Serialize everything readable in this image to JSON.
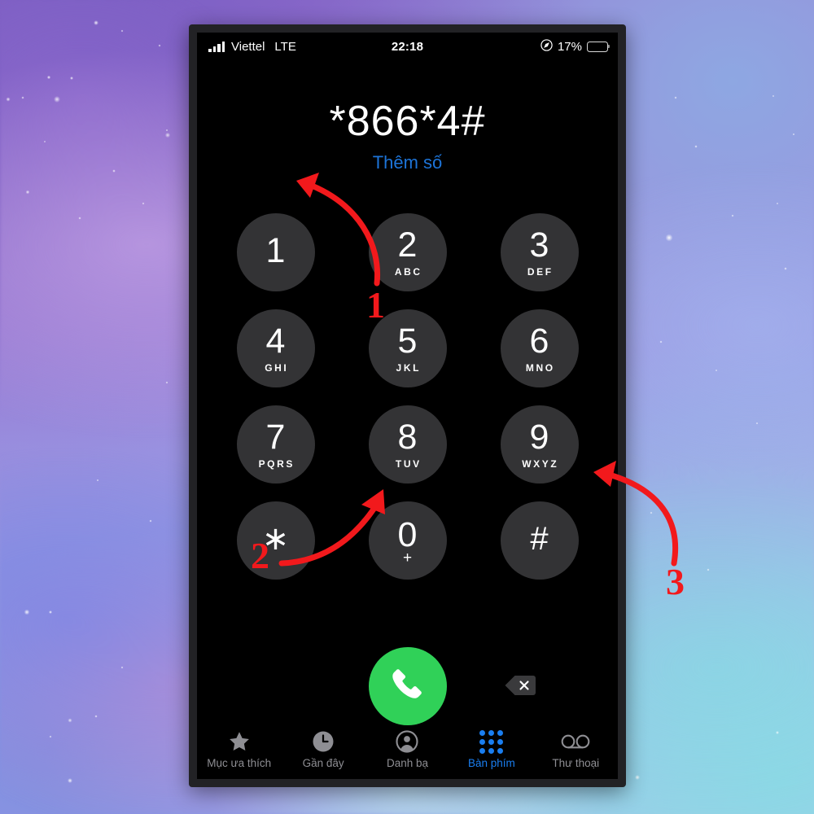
{
  "status_bar": {
    "signal_icon": "signal-bars-icon",
    "carrier": "Viettel",
    "network": "LTE",
    "time": "22:18",
    "location_icon": "location-arrow-icon",
    "battery_percent": "17%",
    "battery_level": 17,
    "battery_color": "#e53027"
  },
  "dialer": {
    "number": "*866*4#",
    "add_number_label": "Thêm số",
    "add_number_color": "#1d74d8",
    "keys": [
      {
        "digit": "1",
        "letters": ""
      },
      {
        "digit": "2",
        "letters": "ABC"
      },
      {
        "digit": "3",
        "letters": "DEF"
      },
      {
        "digit": "4",
        "letters": "GHI"
      },
      {
        "digit": "5",
        "letters": "JKL"
      },
      {
        "digit": "6",
        "letters": "MNO"
      },
      {
        "digit": "7",
        "letters": "PQRS"
      },
      {
        "digit": "8",
        "letters": "TUV"
      },
      {
        "digit": "9",
        "letters": "WXYZ"
      },
      {
        "digit": "∗",
        "letters": ""
      },
      {
        "digit": "0",
        "letters": "+"
      },
      {
        "digit": "#",
        "letters": ""
      }
    ],
    "call_button_icon": "phone-handset-icon",
    "call_button_color": "#30d158",
    "delete_button_icon": "backspace-delete-icon"
  },
  "tab_bar": {
    "active_color": "#1a7ef0",
    "inactive_color": "#8e8e93",
    "tabs": [
      {
        "icon": "star-icon",
        "label": "Mục ưa thích",
        "active": false
      },
      {
        "icon": "clock-icon",
        "label": "Gần đây",
        "active": false
      },
      {
        "icon": "contact-icon",
        "label": "Danh bạ",
        "active": false
      },
      {
        "icon": "keypad-icon",
        "label": "Bàn phím",
        "active": true
      },
      {
        "icon": "voicemail-icon",
        "label": "Thư thoại",
        "active": false
      }
    ]
  },
  "annotations": {
    "color": "#f2191c",
    "markers": [
      {
        "label": "1",
        "description": "arrow from key 2 up-left to number display"
      },
      {
        "label": "2",
        "description": "arrow from star key up-right to key 8"
      },
      {
        "label": "3",
        "description": "arrow from outside right edge pointing to key 9 area"
      }
    ]
  }
}
